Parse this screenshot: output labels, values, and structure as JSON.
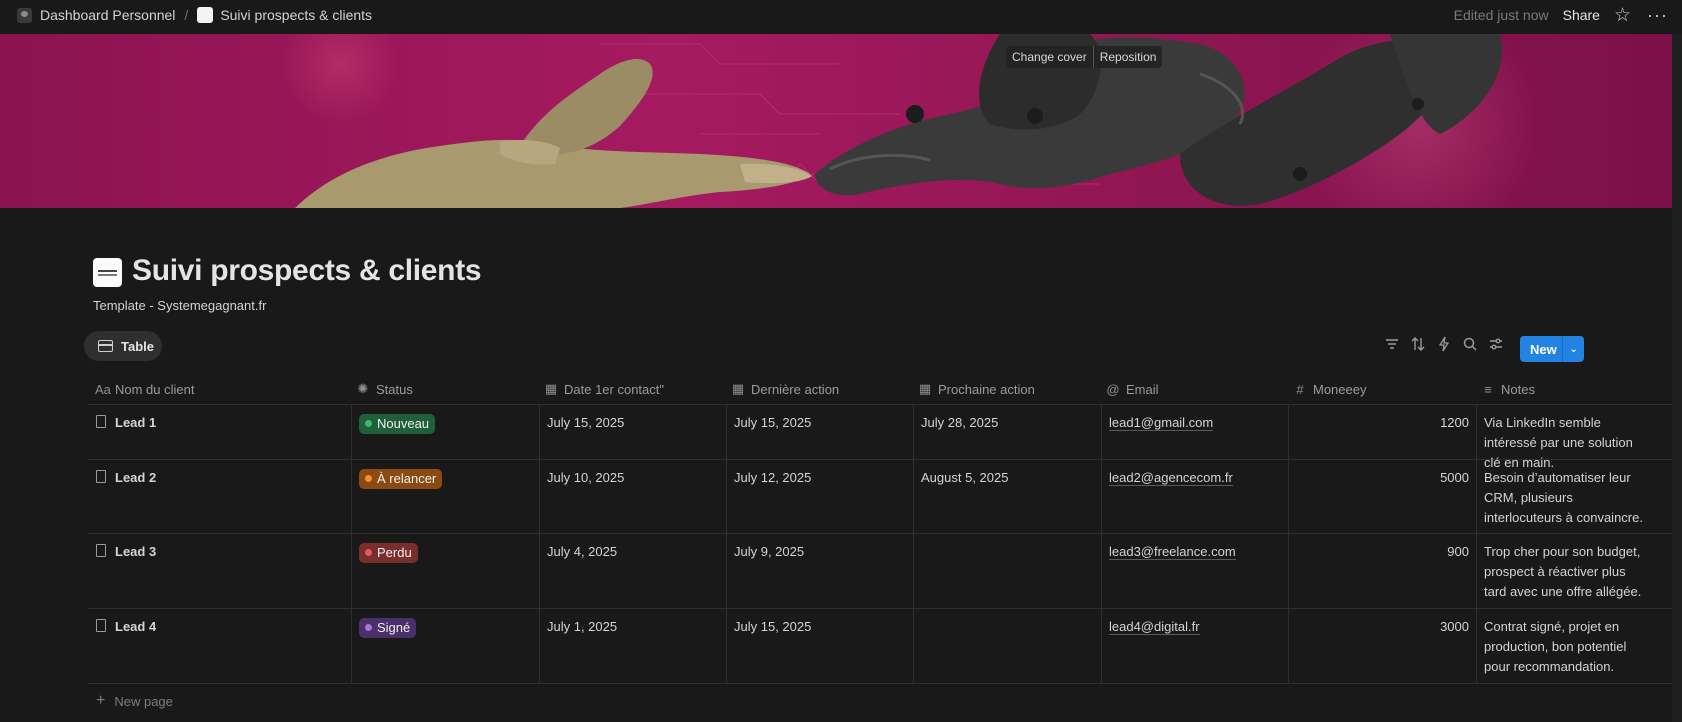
{
  "breadcrumb": {
    "items": [
      "Dashboard Personnel",
      "Suivi prospects & clients"
    ],
    "separator": "/"
  },
  "topbar": {
    "edited": "Edited just now",
    "share_label": "Share",
    "star_icon": "☆",
    "more_icon": "···"
  },
  "cover": {
    "change_label": "Change cover",
    "reposition_label": "Reposition"
  },
  "page": {
    "title": "Suivi prospects & clients",
    "subtitle": "Template - Systemegagnant.fr"
  },
  "view": {
    "tab_label": "Table"
  },
  "toolbar": {
    "icons": [
      "filter-icon",
      "sort-icon",
      "automation-icon",
      "search-icon",
      "settings-icon"
    ],
    "new_label": "New",
    "new_dropdown": "⌄"
  },
  "columns": [
    {
      "label": "Nom du client",
      "icon": "Aa"
    },
    {
      "label": "Status",
      "icon": "✺"
    },
    {
      "label": "Date 1er contact\"",
      "icon": "▦"
    },
    {
      "label": "Dernière action",
      "icon": "▦"
    },
    {
      "label": "Prochaine action",
      "icon": "▦"
    },
    {
      "label": "Email",
      "icon": "@"
    },
    {
      "label": "Moneeey",
      "icon": "#"
    },
    {
      "label": "Notes",
      "icon": "≡"
    }
  ],
  "colors": {
    "accent": "#2383e2",
    "status_nouveau_bg": "#1f5f3b",
    "status_nouveau_dot": "#3fb86c",
    "status_relancer_bg": "#8a4a12",
    "status_relancer_dot": "#f0912b",
    "status_perdu_bg": "#7a2d2d",
    "status_perdu_dot": "#eb5757",
    "status_signe_bg": "#4b2f6b",
    "status_signe_dot": "#a774d9"
  },
  "rows": [
    {
      "name": "Lead 1",
      "status": "Nouveau",
      "status_key": "nouveau",
      "first_contact": "July 15, 2025",
      "last_action": "July 15, 2025",
      "next_action": "July 28, 2025",
      "email": "lead1@gmail.com",
      "money": "1200",
      "notes": "Via LinkedIn semble intéressé par une solution clé en main."
    },
    {
      "name": "Lead 2",
      "status": "À relancer",
      "status_key": "relancer",
      "first_contact": "July 10, 2025",
      "last_action": "July 12, 2025",
      "next_action": "August 5, 2025",
      "email": "lead2@agencecom.fr",
      "money": "5000",
      "notes": "Besoin d’automatiser leur CRM, plusieurs interlocuteurs à convaincre."
    },
    {
      "name": "Lead 3",
      "status": "Perdu",
      "status_key": "perdu",
      "first_contact": "July 4, 2025",
      "last_action": "July 9, 2025",
      "next_action": "",
      "email": "lead3@freelance.com",
      "money": "900",
      "notes": "Trop cher pour son budget, prospect à réactiver plus tard avec une offre allégée."
    },
    {
      "name": "Lead 4",
      "status": "Signé",
      "status_key": "signe",
      "first_contact": "July 1, 2025",
      "last_action": "July 15, 2025",
      "next_action": "",
      "email": "lead4@digital.fr",
      "money": "3000",
      "notes": "Contrat signé, projet en production, bon potentiel pour recommandation."
    }
  ],
  "new_page_label": "New page"
}
